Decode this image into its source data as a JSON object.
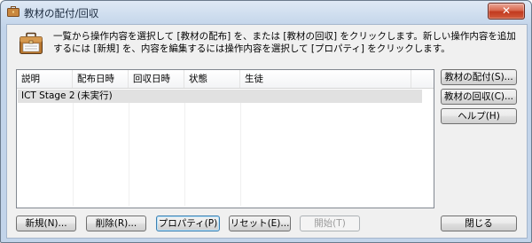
{
  "window": {
    "title": "教材の配付/回収",
    "close_glyph": "✕"
  },
  "description": "一覧から操作内容を選択して [教材の配布] を、または [教材の回収] をクリックします。新しい操作内容を追加するには [新規] を、内容を編集するには操作内容を選択して [プロパティ] をクリックします。",
  "list": {
    "columns": [
      "説明",
      "配布日時",
      "回収日時",
      "状態",
      "生徒"
    ],
    "rows": [
      {
        "description": "ICT Stage 2",
        "distributed": "(未実行)",
        "collected": "",
        "status": "",
        "students": ""
      }
    ]
  },
  "side_buttons": {
    "distribute": "教材の配付(S)...",
    "collect": "教材の回収(C)...",
    "help": "ヘルプ(H)"
  },
  "bottom_buttons": {
    "new": "新規(N)...",
    "delete": "削除(R)...",
    "properties": "プロパティ(P)",
    "reset": "リセット(E)...",
    "start": "開始(T)",
    "close": "閉じる"
  },
  "colors": {
    "titlebar": "#c9d9ec",
    "close_button": "#c23a1f",
    "focus_border": "#3c7fb1",
    "selected_row": "#e1e1e1"
  },
  "icons": {
    "app": "briefcase-icon",
    "header": "briefcase-icon",
    "close": "close-icon"
  }
}
